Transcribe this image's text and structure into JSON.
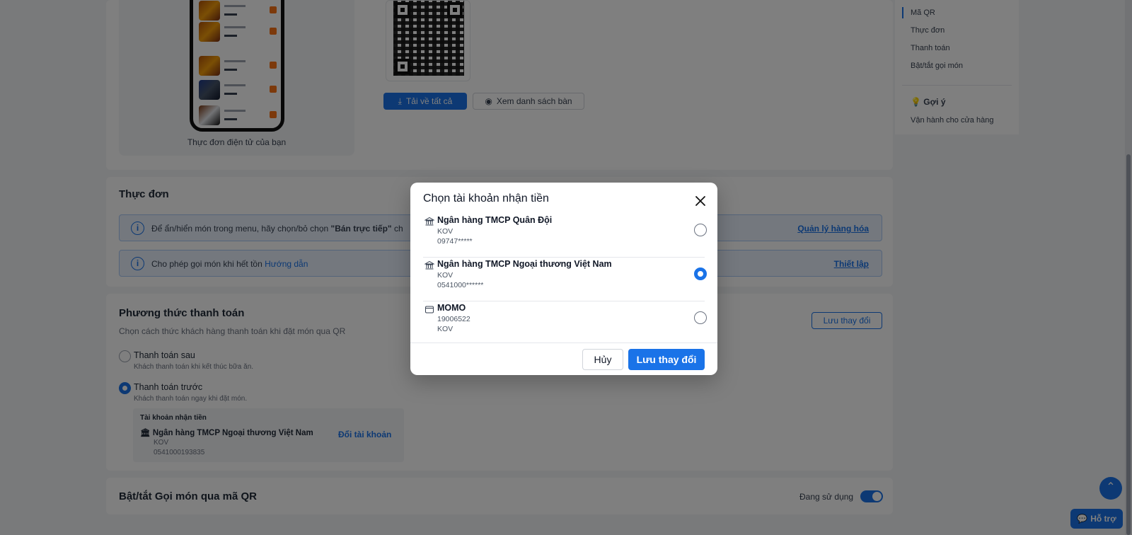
{
  "background": {
    "menu_preview": {
      "caption": "Thực đơn điện tử của bạn"
    },
    "qr_actions": {
      "download_all": "Tải về tất cả",
      "view_table_list": "Xem danh sách bàn"
    },
    "menu_section": {
      "title": "Thực đơn",
      "notice1": {
        "prefix": "Để ẩn/hiển món trong menu, hãy chọn/bỏ chọn",
        "bold": "\"Bán trực tiếp\"",
        "suffix": "ch",
        "link": "Quản lý hàng hóa"
      },
      "notice2": {
        "text": "Cho phép gọi món khi hết tồn",
        "guide": "Hướng dẫn",
        "link": "Thiết lập"
      }
    },
    "payment_section": {
      "title": "Phương thức thanh toán",
      "subtitle": "Chọn cách thức khách hàng thanh toán khi đặt món qua QR",
      "save_button": "Lưu thay đổi",
      "options": [
        {
          "label": "Thanh toán sau",
          "description": "Khách thanh toán khi kết thúc bữa ăn.",
          "selected": false
        },
        {
          "label": "Thanh toán trước",
          "description": "Khách thanh toán ngay khi đặt món.",
          "selected": true
        }
      ],
      "receiving_account": {
        "heading": "Tài khoản nhận tiền",
        "bank": "Ngân hàng TMCP Ngoại thương Việt Nam",
        "holder": "KOV",
        "number": "0541000193835",
        "change_link": "Đổi tài khoản"
      }
    },
    "qr_toggle_section": {
      "title": "Bật/tắt Gọi món qua mã QR",
      "status": "Đang sử dụng",
      "enabled": true
    },
    "sidebar": {
      "items": [
        "Mã QR",
        "Thực đơn",
        "Thanh toán",
        "Bật/tắt gọi món"
      ],
      "active_index": 0,
      "suggestion_title": "Gợi ý",
      "suggestion_item": "Vận hành cho cửa hàng"
    },
    "help_button": "Hỗ trợ"
  },
  "modal": {
    "title": "Chọn tài khoản nhận tiền",
    "accounts": [
      {
        "icon": "bank-icon",
        "name": "Ngân hàng TMCP Quân Đội",
        "line2": "KOV",
        "line3": "09747*****",
        "selected": false
      },
      {
        "icon": "bank-icon",
        "name": "Ngân hàng TMCP Ngoại thương Việt Nam",
        "line2": "KOV",
        "line3": "0541000******",
        "selected": true
      },
      {
        "icon": "wallet-icon",
        "name": "MOMO",
        "line2": "19006522",
        "line3": "KOV",
        "selected": false
      }
    ],
    "cancel_label": "Hủy",
    "save_label": "Lưu thay đổi"
  },
  "colors": {
    "primary": "#1a73e8",
    "overlay": "rgba(0,0,0,0.5)"
  }
}
